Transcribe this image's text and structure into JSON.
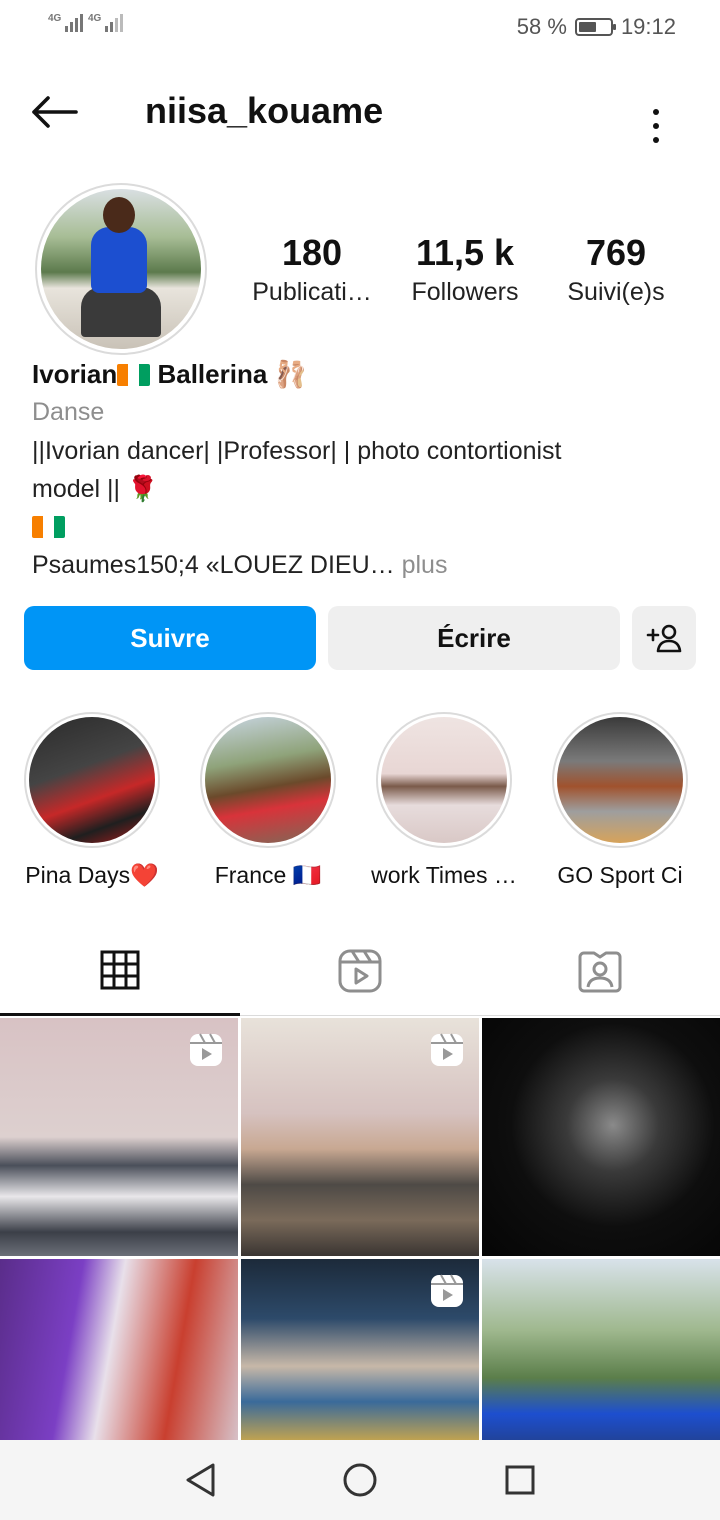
{
  "status_bar": {
    "network_1": "4G",
    "network_2": "4G",
    "battery_text": "58 %",
    "battery_level": 0.58,
    "time": "19:12"
  },
  "header": {
    "username": "niisa_kouame",
    "back_icon": "arrow-left-icon",
    "menu_icon": "more-vertical-icon"
  },
  "profile": {
    "stats": [
      {
        "value": "180",
        "label": "Publicati…"
      },
      {
        "value": "11,5 k",
        "label": "Followers"
      },
      {
        "value": "769",
        "label": "Suivi(e)s"
      }
    ],
    "name_prefix": "Ivorian",
    "name_suffix": " Ballerina 🩰",
    "category": "Danse",
    "bio_line1": "||Ivorian dancer| |Professor| | photo contortionist",
    "bio_line2": "model || 🌹",
    "bio_line4": "Psaumes150;4 «LOUEZ DIEU…",
    "more_label": " plus",
    "flag_colors": [
      "#f77f00",
      "#ffffff",
      "#009e60"
    ]
  },
  "actions": {
    "follow_label": "Suivre",
    "message_label": "Écrire",
    "add_user_icon": "add-user-icon"
  },
  "highlights": [
    {
      "label": "Pina Days❤️"
    },
    {
      "label": "France 🇫🇷"
    },
    {
      "label": "work Times …"
    },
    {
      "label": "GO Sport Ci"
    }
  ],
  "tabs": [
    {
      "icon": "grid-icon",
      "active": true
    },
    {
      "icon": "reels-icon",
      "active": false
    },
    {
      "icon": "tagged-icon",
      "active": false
    }
  ],
  "nav": {
    "back": "triangle-back-icon",
    "home": "circle-home-icon",
    "recents": "square-recents-icon"
  },
  "colors": {
    "accent": "#0095f6",
    "secondary_button": "#efefef",
    "muted_text": "#8e8e8e"
  }
}
